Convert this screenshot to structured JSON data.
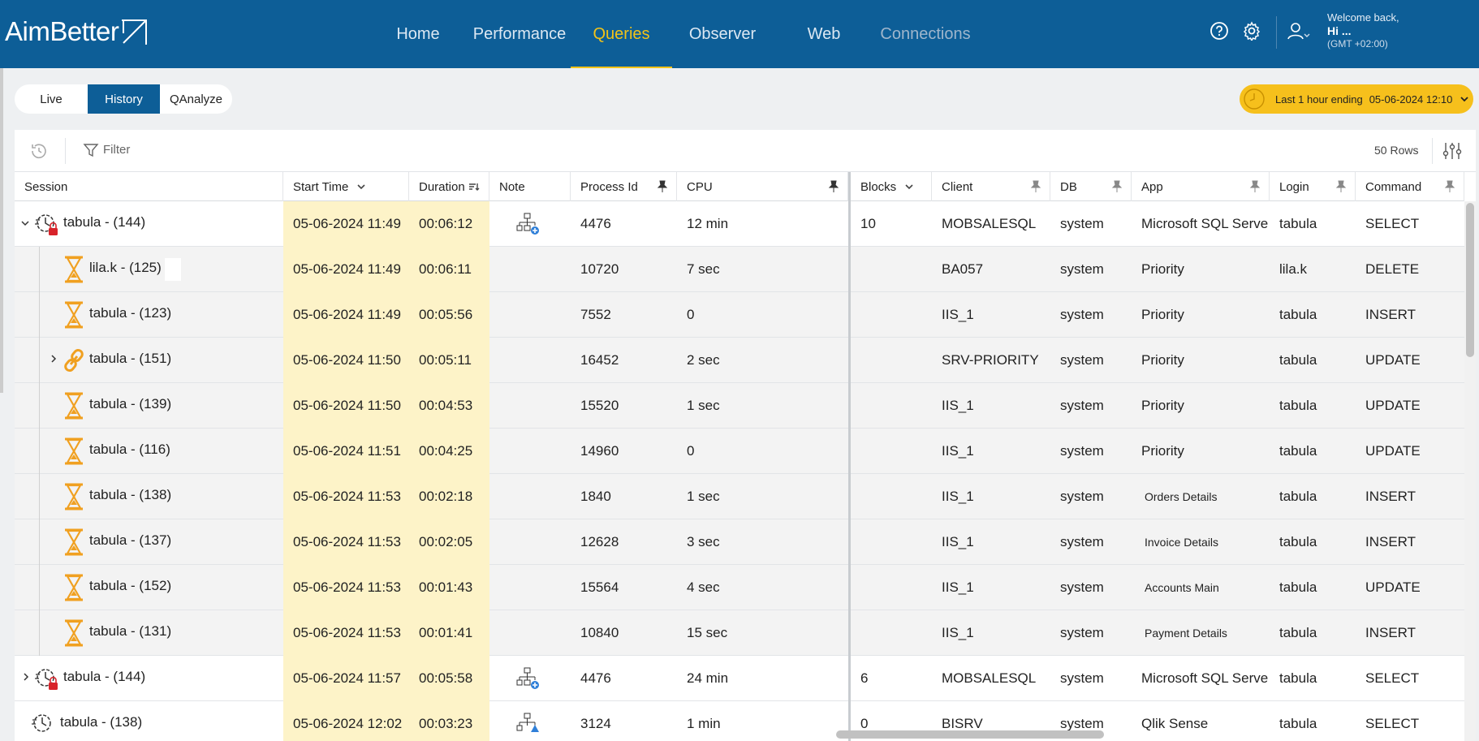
{
  "brand": {
    "name": "AimBetter"
  },
  "nav": [
    {
      "label": "Home"
    },
    {
      "label": "Performance"
    },
    {
      "label": "Queries"
    },
    {
      "label": "Observer"
    },
    {
      "label": "Web"
    },
    {
      "label": "Connections"
    }
  ],
  "user": {
    "welcome": "Welcome back,",
    "name": "Hi ...",
    "tz": "(GMT +02:00)"
  },
  "modes": [
    {
      "label": "Live"
    },
    {
      "label": "History"
    },
    {
      "label": "QAnalyze"
    }
  ],
  "time_range": {
    "label": "Last 1 hour ending",
    "value": "05-06-2024 12:10"
  },
  "toolbar": {
    "filter_placeholder": "Filter",
    "rows_count": "50 Rows"
  },
  "columns": [
    "Session",
    "Start Time",
    "Duration",
    "Note",
    "Process Id",
    "CPU",
    "Blocks",
    "Client",
    "DB",
    "App",
    "Login",
    "Command"
  ],
  "rows": [
    {
      "session": "tabula - (144)",
      "start": "05-06-2024 11:49",
      "duration": "00:06:12",
      "pid": "4476",
      "cpu": "12 min",
      "blocks": "10",
      "client": "MOBSALESQL",
      "db": "system",
      "app": "Microsoft SQL Serve",
      "login": "tabula",
      "command": "SELECT"
    },
    {
      "session": "lila.k - (125)",
      "start": "05-06-2024 11:49",
      "duration": "00:06:11",
      "pid": "10720",
      "cpu": "7 sec",
      "blocks": "",
      "client": "BA057",
      "db": "system",
      "app": "Priority",
      "login": "lila.k",
      "command": "DELETE"
    },
    {
      "session": "tabula - (123)",
      "start": "05-06-2024 11:49",
      "duration": "00:05:56",
      "pid": "7552",
      "cpu": "0",
      "blocks": "",
      "client": "IIS_1",
      "db": "system",
      "app": "Priority",
      "login": "tabula",
      "command": "INSERT"
    },
    {
      "session": "tabula - (151)",
      "start": "05-06-2024 11:50",
      "duration": "00:05:11",
      "pid": "16452",
      "cpu": "2 sec",
      "blocks": "",
      "client": "SRV-PRIORITY",
      "db": "system",
      "app": "Priority",
      "login": "tabula",
      "command": "UPDATE"
    },
    {
      "session": "tabula - (139)",
      "start": "05-06-2024 11:50",
      "duration": "00:04:53",
      "pid": "15520",
      "cpu": "1 sec",
      "blocks": "",
      "client": "IIS_1",
      "db": "system",
      "app": "Priority",
      "login": "tabula",
      "command": "UPDATE"
    },
    {
      "session": "tabula - (116)",
      "start": "05-06-2024 11:51",
      "duration": "00:04:25",
      "pid": "14960",
      "cpu": "0",
      "blocks": "",
      "client": "IIS_1",
      "db": "system",
      "app": "Priority",
      "login": "tabula",
      "command": "UPDATE"
    },
    {
      "session": "tabula - (138)",
      "start": "05-06-2024 11:53",
      "duration": "00:02:18",
      "pid": "1840",
      "cpu": "1 sec",
      "blocks": "",
      "client": "IIS_1",
      "db": "system",
      "app": "Orders Details",
      "login": "tabula",
      "command": "INSERT"
    },
    {
      "session": "tabula - (137)",
      "start": "05-06-2024 11:53",
      "duration": "00:02:05",
      "pid": "12628",
      "cpu": "3 sec",
      "blocks": "",
      "client": "IIS_1",
      "db": "system",
      "app": "Invoice Details",
      "login": "tabula",
      "command": "INSERT"
    },
    {
      "session": "tabula - (152)",
      "start": "05-06-2024 11:53",
      "duration": "00:01:43",
      "pid": "15564",
      "cpu": "4 sec",
      "blocks": "",
      "client": "IIS_1",
      "db": "system",
      "app": "Accounts Main",
      "login": "tabula",
      "command": "UPDATE"
    },
    {
      "session": "tabula - (131)",
      "start": "05-06-2024 11:53",
      "duration": "00:01:41",
      "pid": "10840",
      "cpu": "15 sec",
      "blocks": "",
      "client": "IIS_1",
      "db": "system",
      "app": "Payment Details",
      "login": "tabula",
      "command": "INSERT"
    },
    {
      "session": "tabula - (144)",
      "start": "05-06-2024 11:57",
      "duration": "00:05:58",
      "pid": "4476",
      "cpu": "24 min",
      "blocks": "6",
      "client": "MOBSALESQL",
      "db": "system",
      "app": "Microsoft SQL Serve",
      "login": "tabula",
      "command": "SELECT"
    },
    {
      "session": "tabula - (138)",
      "start": "05-06-2024 12:02",
      "duration": "00:03:23",
      "pid": "3124",
      "cpu": "1 min",
      "blocks": "0",
      "client": "BISRV",
      "db": "system",
      "app": "Qlik Sense",
      "login": "tabula",
      "command": "SELECT"
    }
  ],
  "colors": {
    "header_bg": "#0d5e97",
    "accent": "#f2c318",
    "time_highlight": "#fdf3c8",
    "hourglass": "#f0a020"
  }
}
